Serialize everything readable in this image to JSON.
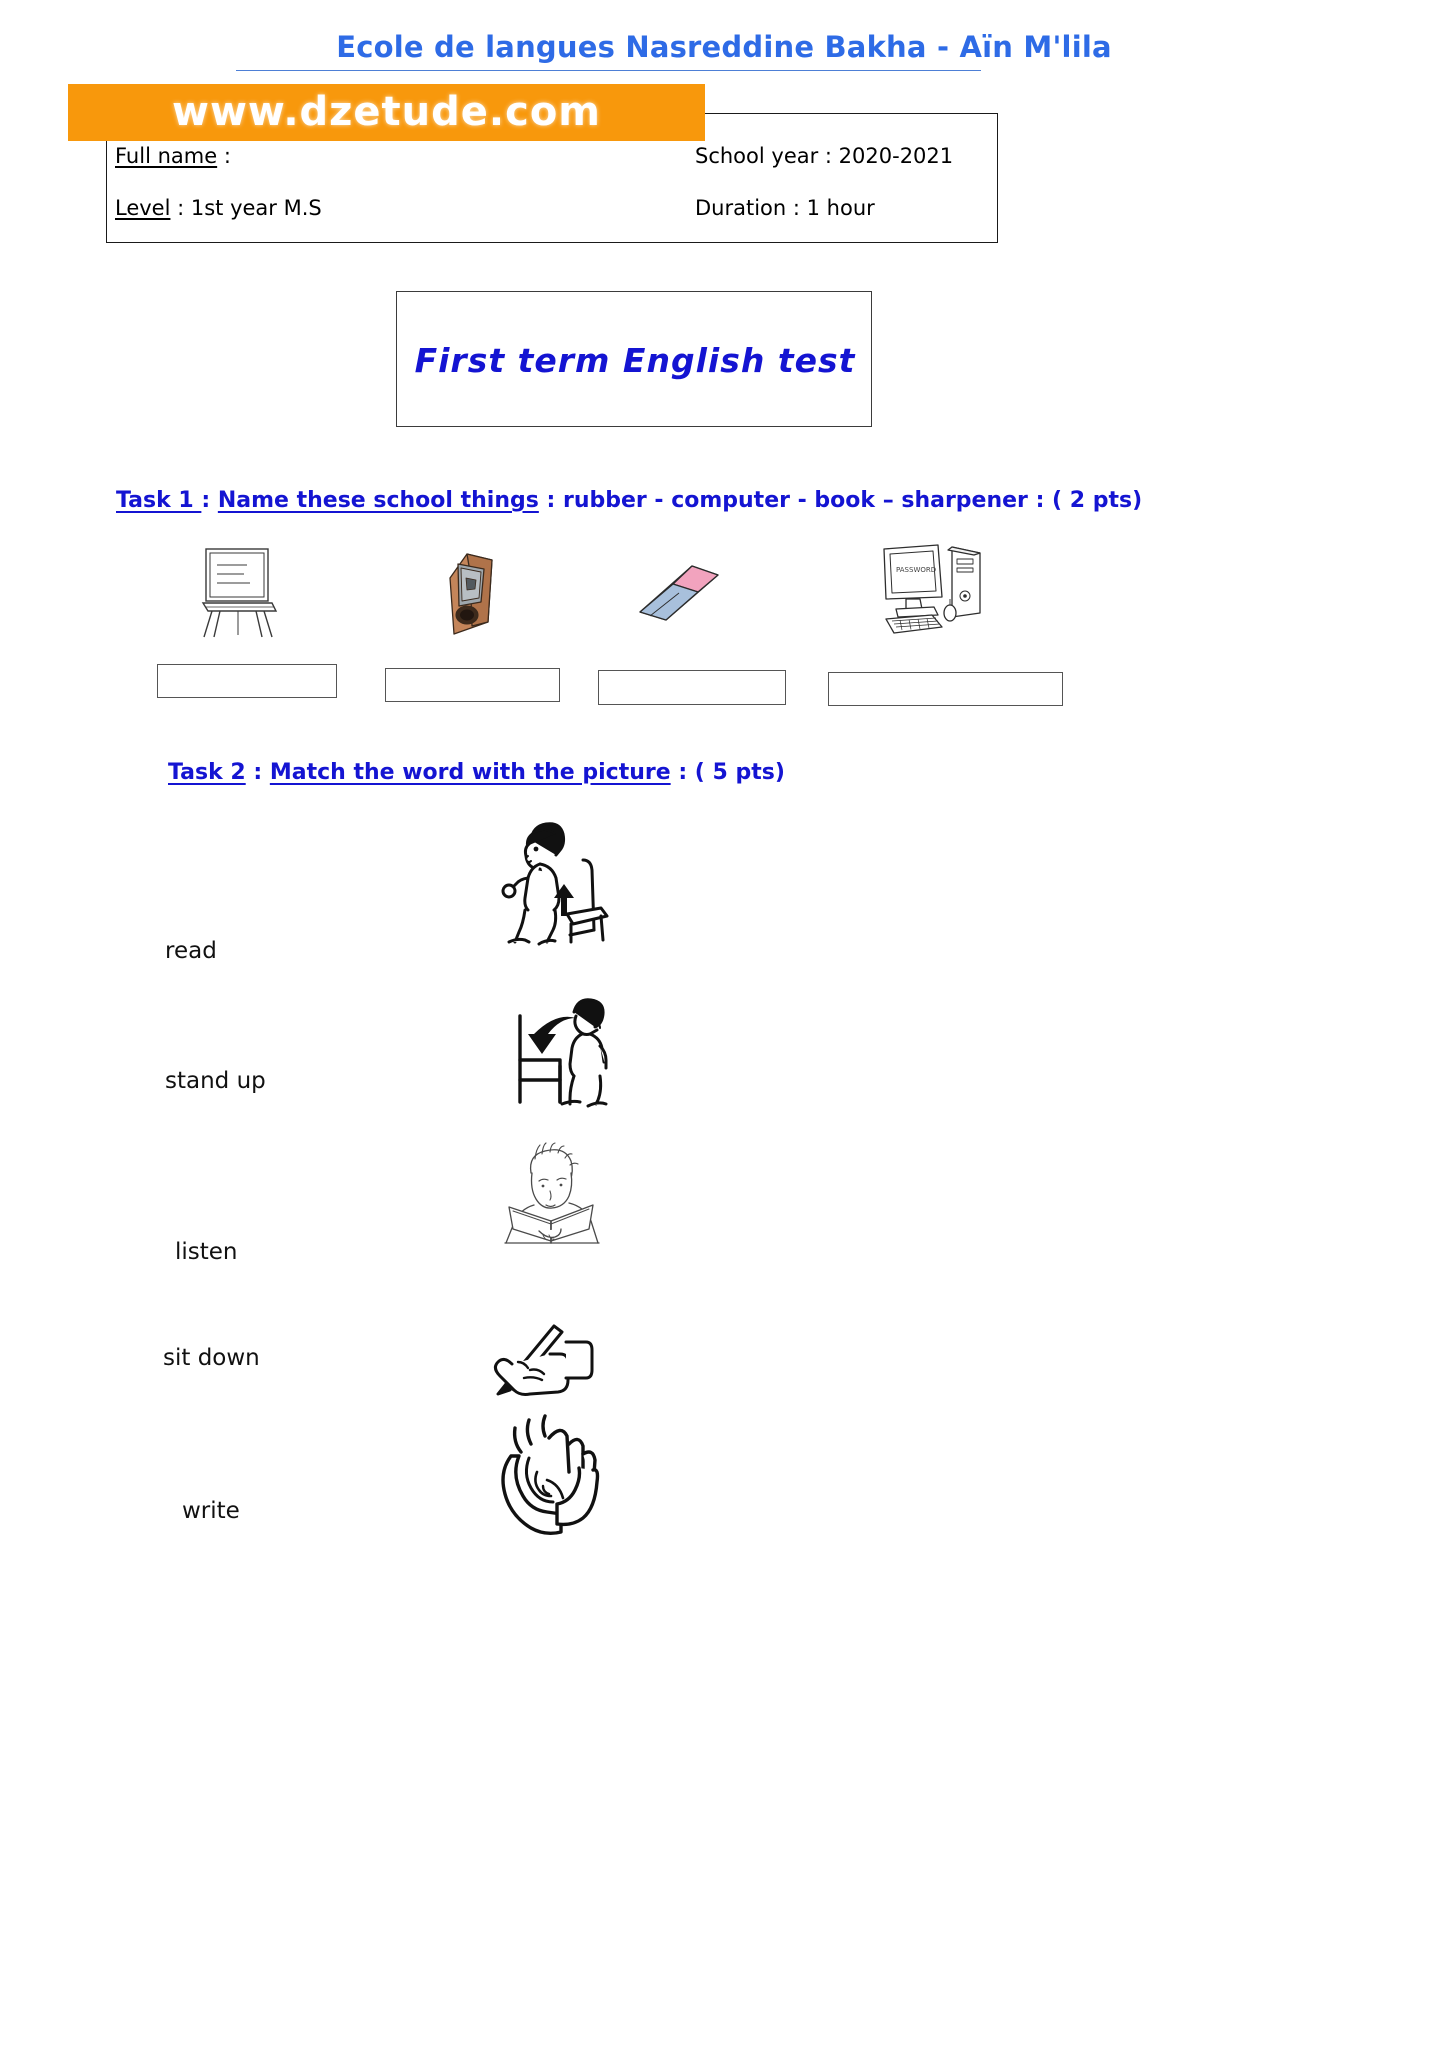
{
  "header": {
    "school_title": "Ecole de langues Nasreddine Bakha - Aïn M'lila",
    "watermark_text": "www.dzetude.com",
    "watermark_color": "#F8980C",
    "title_color": "#2E6BE6"
  },
  "info_box": {
    "full_name_label": "Full name",
    "full_name_value": " :",
    "level_label": "Level",
    "level_value": " : 1st year M.S",
    "school_year_label": "School year : 2020-2021",
    "duration_label": "Duration : 1 hour"
  },
  "test_title": {
    "text": "First term English test",
    "color": "#1414D2"
  },
  "task1": {
    "number": "Task 1 ",
    "separator1": " : ",
    "instruction": "Name these school things",
    "separator2": " :  ",
    "word_bank": "rubber - computer - book – sharpener",
    "separator3": " : ",
    "points": "( 2 pts)",
    "pictures": [
      {
        "name": "flipchart-board-picture",
        "alt": "board on easel"
      },
      {
        "name": "pencil-sharpener-picture",
        "alt": "wooden pencil sharpener"
      },
      {
        "name": "eraser-rubber-picture",
        "alt": "pink and blue eraser"
      },
      {
        "name": "computer-picture",
        "alt": "desktop computer with monitor, keyboard and tower"
      }
    ],
    "answer_boxes": [
      "",
      "",
      "",
      ""
    ]
  },
  "task2": {
    "number": "Task 2",
    "separator1": " : ",
    "instruction": "Match the word with the picture",
    "separator2": " : ",
    "points": "( 5 pts)",
    "words": [
      "read",
      "stand up",
      "listen",
      "sit down",
      "write"
    ],
    "pictures": [
      {
        "name": "stand-up-picture",
        "alt": "boy standing up from chair with up arrow"
      },
      {
        "name": "sit-down-picture",
        "alt": "person sitting down on chair with down arrow"
      },
      {
        "name": "read-picture",
        "alt": "boy reading an open book"
      },
      {
        "name": "write-picture",
        "alt": "hand holding pencil writing"
      },
      {
        "name": "listen-picture",
        "alt": "hand cupped behind ear listening"
      }
    ]
  }
}
